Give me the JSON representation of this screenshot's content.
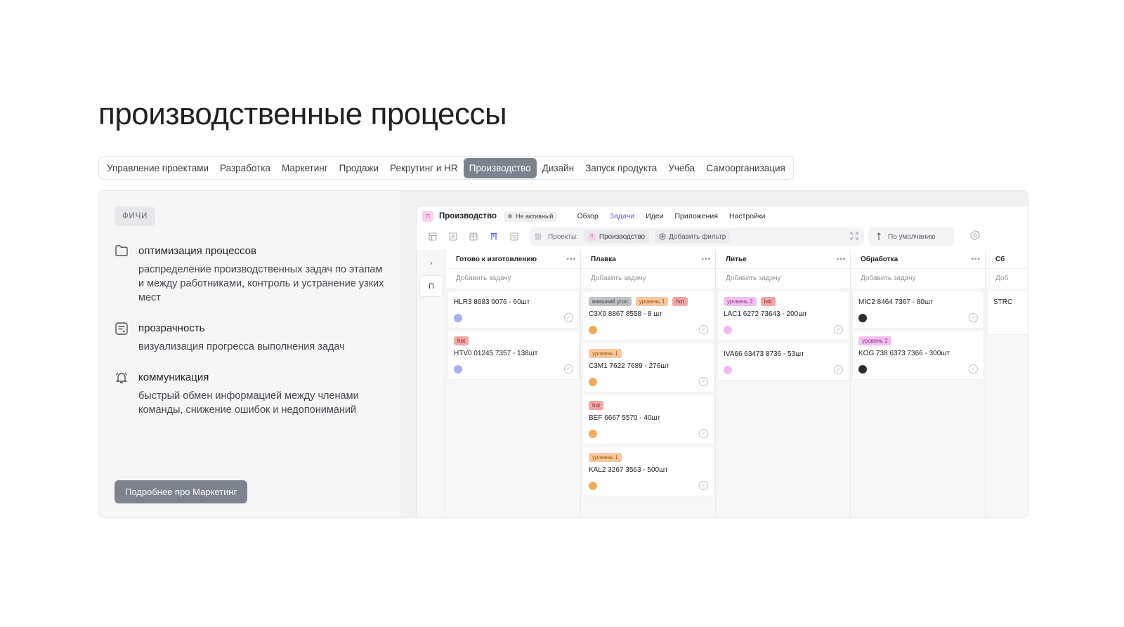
{
  "page_title": "производственные процессы",
  "tabs": [
    {
      "label": "Управление проектами",
      "active": false
    },
    {
      "label": "Разработка",
      "active": false
    },
    {
      "label": "Маркетинг",
      "active": false
    },
    {
      "label": "Продажи",
      "active": false
    },
    {
      "label": "Рекрутинг и HR",
      "active": false
    },
    {
      "label": "Производство",
      "active": true
    },
    {
      "label": "Дизайн",
      "active": false
    },
    {
      "label": "Запуск продукта",
      "active": false
    },
    {
      "label": "Учеба",
      "active": false
    },
    {
      "label": "Самоорганизация",
      "active": false
    }
  ],
  "features_chip": "ФИЧИ",
  "features": [
    {
      "icon": "folder-icon",
      "title": "оптимизация процессов",
      "desc": "распределение производственных задач по этапам и между работниками, контроль и устранение узких мест"
    },
    {
      "icon": "document-list-icon",
      "title": "прозрачность",
      "desc": "визуализация прогресса выполнения задач"
    },
    {
      "icon": "bell-icon",
      "title": "коммуникация",
      "desc": "быстрый обмен информацией между членами команды, снижение ошибок и недопониманий"
    }
  ],
  "more_button": "Подробнее про Маркетинг",
  "app": {
    "project_avatar": "П",
    "project_name": "Производство",
    "status": "Не активный",
    "nav": [
      {
        "label": "Обзор",
        "active": false
      },
      {
        "label": "Задачи",
        "active": true
      },
      {
        "label": "Идеи",
        "active": false
      },
      {
        "label": "Приложения",
        "active": false
      },
      {
        "label": "Настройки",
        "active": false
      }
    ],
    "filter": {
      "projects_label": "Проекты:",
      "project_avatar": "П",
      "project_value": "Производство",
      "add_filter": "Добавить фильтр"
    },
    "sort_label": "По умолчанию",
    "rail": {
      "expand": "›",
      "project_letter": "П"
    },
    "columns": [
      {
        "title": "Готово к изготовлению",
        "add_task": "Добавить задачу",
        "cards": [
          {
            "tags": [],
            "text": "HLR3 8683 0076 - 60шт",
            "avatar": "purple"
          },
          {
            "tags": [
              {
                "label": "hot",
                "kind": "hot"
              }
            ],
            "text": "HTV0 01245 7357 - 138шт",
            "avatar": "purple"
          }
        ]
      },
      {
        "title": "Плавка",
        "add_task": "Добавить задачу",
        "cards": [
          {
            "tags": [
              {
                "label": "внешний угол",
                "kind": "grey"
              },
              {
                "label": "уровень 1",
                "kind": "lvl1"
              },
              {
                "label": "hot",
                "kind": "hot"
              }
            ],
            "text": "C3X0 8867 8558 - 8 шт",
            "avatar": "orange"
          },
          {
            "tags": [
              {
                "label": "уровень 1",
                "kind": "lvl1"
              }
            ],
            "text": "C3M1 7622 7689 - 276шт",
            "avatar": "orange"
          },
          {
            "tags": [
              {
                "label": "hot",
                "kind": "hot"
              }
            ],
            "text": "BEF 6667 5570 - 40шт",
            "avatar": "orange"
          },
          {
            "tags": [
              {
                "label": "уровень 1",
                "kind": "lvl1"
              }
            ],
            "text": "KAL2 3267 3563 - 500шт",
            "avatar": "orange"
          }
        ]
      },
      {
        "title": "Литье",
        "add_task": "Добавить задачу",
        "cards": [
          {
            "tags": [
              {
                "label": "уровень 2",
                "kind": "lvl2"
              },
              {
                "label": "hot",
                "kind": "hot"
              }
            ],
            "text": "LAC1 6272 73643 - 200шт",
            "avatar": "pink"
          },
          {
            "tags": [],
            "text": "IVA66 63473 8736 - 53шт",
            "avatar": "pink"
          }
        ]
      },
      {
        "title": "Обработка",
        "add_task": "Добавить задачу",
        "cards": [
          {
            "tags": [],
            "text": "MIC2 8464 7367 - 80шт",
            "avatar": "dark"
          },
          {
            "tags": [
              {
                "label": "уровень 2",
                "kind": "lvl2"
              }
            ],
            "text": "KOG 738 6373 7366 - 300шт",
            "avatar": "dark"
          }
        ]
      },
      {
        "title": "Сб",
        "add_task": "Доб",
        "cards": [
          {
            "tags": [],
            "text": "STRC",
            "avatar": ""
          }
        ]
      }
    ]
  }
}
